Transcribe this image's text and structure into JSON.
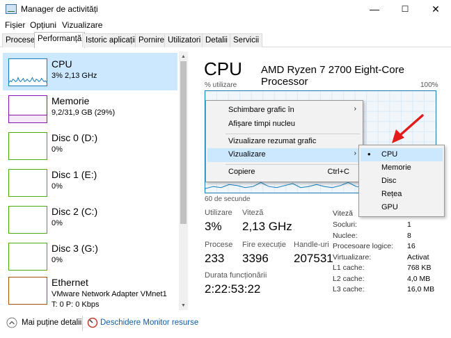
{
  "window": {
    "title": "Manager de activități",
    "minimize": "—",
    "maximize": "☐",
    "close": "✕"
  },
  "menubar": [
    "Fișier",
    "Opțiuni",
    "Vizualizare"
  ],
  "tabs": [
    "Procese",
    "Performanță",
    "Istoric aplicații",
    "Pornire",
    "Utilizatori",
    "Detalii",
    "Servicii"
  ],
  "active_tab": "Performanță",
  "sidebar": {
    "items": [
      {
        "title": "CPU",
        "sub": "3% 2,13 GHz",
        "color": "#117dbb"
      },
      {
        "title": "Memorie",
        "sub": "9,2/31,9 GB (29%)",
        "color": "#8b12ae"
      },
      {
        "title": "Disc 0 (D:)",
        "sub": "0%",
        "color": "#4da60c"
      },
      {
        "title": "Disc 1 (E:)",
        "sub": "0%",
        "color": "#4da60c"
      },
      {
        "title": "Disc 2 (C:)",
        "sub": "0%",
        "color": "#4da60c"
      },
      {
        "title": "Disc 3 (G:)",
        "sub": "0%",
        "color": "#4da60c"
      },
      {
        "title": "Ethernet",
        "sub": "VMware Network Adapter VMnet1",
        "sub2": "T: 0 P: 0 Kbps",
        "color": "#a74f01"
      }
    ]
  },
  "cpu": {
    "heading": "CPU",
    "model": "AMD Ryzen 7 2700 Eight-Core Processor",
    "util_label": "% utilizare",
    "util_max": "100%",
    "seconds": "60 de secunde",
    "graph_values": [
      0.04,
      0.06,
      0.05,
      0.08,
      0.07,
      0.05,
      0.06,
      0.1,
      0.06,
      0.05,
      0.07,
      0.09,
      0.05,
      0.06,
      0.08,
      0.06,
      0.05,
      0.07,
      0.1,
      0.06,
      0.05,
      0.08,
      0.07,
      0.05,
      0.06,
      0.09,
      0.07,
      0.05,
      0.06,
      0.04
    ],
    "stats": {
      "utilizare_label": "Utilizare",
      "utilizare": "3%",
      "viteza_label": "Viteză",
      "viteza": "2,13 GHz",
      "procese_label": "Procese",
      "procese": "233",
      "fire_label": "Fire execuție",
      "fire": "3396",
      "handle_label": "Handle-uri",
      "handle": "207531",
      "durata_label": "Durata funcționării",
      "durata": "2:22:53:22"
    },
    "specs": [
      {
        "label": "Viteză",
        "value": ""
      },
      {
        "label": "Socluri:",
        "value": "1"
      },
      {
        "label": "Nuclee:",
        "value": "8"
      },
      {
        "label": "Procesoare logice:",
        "value": "16"
      },
      {
        "label": "Virtualizare:",
        "value": "Activat"
      },
      {
        "label": "L1 cache:",
        "value": "768 KB"
      },
      {
        "label": "L2 cache:",
        "value": "4,0 MB"
      },
      {
        "label": "L3 cache:",
        "value": "16,0 MB"
      }
    ]
  },
  "context_menu": {
    "items": [
      {
        "label": "Schimbare grafic în",
        "submenu": true
      },
      {
        "label": "Afișare timpi nucleu"
      },
      {
        "label": "Vizualizare rezumat grafic"
      },
      {
        "label": "Vizualizare",
        "submenu": true,
        "highlighted": true
      },
      {
        "label": "Copiere",
        "shortcut": "Ctrl+C"
      }
    ]
  },
  "submenu": {
    "items": [
      {
        "label": "CPU",
        "checked": true
      },
      {
        "label": "Memorie"
      },
      {
        "label": "Disc"
      },
      {
        "label": "Rețea"
      },
      {
        "label": "GPU"
      }
    ]
  },
  "footer": {
    "less_details": "Mai puține detalii",
    "resource_monitor": "Deschidere Monitor resurse"
  },
  "colors": {
    "cpu": "#117dbb",
    "annotation_arrow": "#e21b1b",
    "selection": "#cce8ff"
  }
}
